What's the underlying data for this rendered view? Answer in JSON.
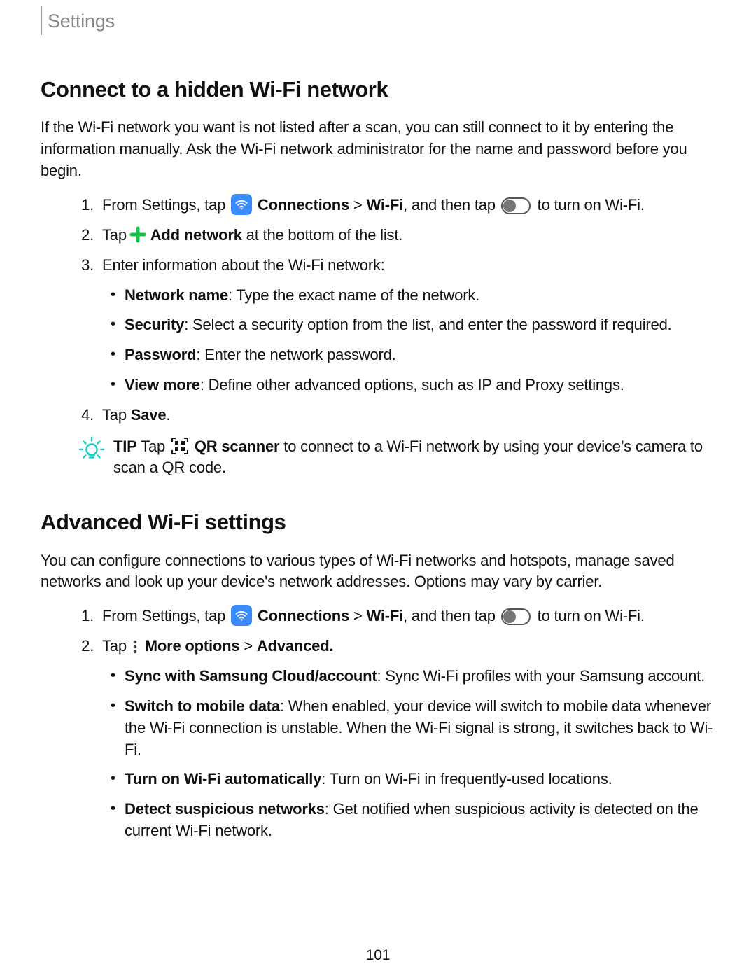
{
  "breadcrumb": "Settings",
  "page_number": "101",
  "s1": {
    "heading": "Connect to a hidden Wi-Fi network",
    "lead": "If the Wi-Fi network you want is not listed after a scan, you can still connect to it by entering the information manually. Ask the Wi-Fi network administrator for the name and password before you begin.",
    "step1_pre": "From Settings, tap ",
    "step1_conn": "Connections",
    "step1_gt": " > ",
    "step1_wifi": "Wi-Fi",
    "step1_mid": ", and then tap ",
    "step1_post": " to turn on Wi-Fi.",
    "step2_pre": "Tap ",
    "step2_add": "Add network",
    "step2_post": " at the bottom of the list.",
    "step3": "Enter information about the Wi-Fi network:",
    "b_name_l": "Network name",
    "b_name_t": ": Type the exact name of the network.",
    "b_sec_l": "Security",
    "b_sec_t": ": Select a security option from the list, and enter the password if required.",
    "b_pw_l": "Password",
    "b_pw_t": ": Enter the network password.",
    "b_vm_l": "View more",
    "b_vm_t": ": Define other advanced options, such as IP and Proxy settings.",
    "step4_pre": "Tap ",
    "step4_save": "Save",
    "step4_post": ".",
    "tip_label": "TIP",
    "tip_pre": "  Tap ",
    "tip_qr": "QR scanner",
    "tip_post": " to connect to a Wi-Fi network by using your device’s camera to scan a QR code."
  },
  "s2": {
    "heading": "Advanced Wi-Fi settings",
    "lead": "You can configure connections to various types of Wi-Fi networks and hotspots, manage saved networks and look up your device's network addresses. Options may vary by carrier.",
    "step1_pre": "From Settings, tap ",
    "step1_conn": "Connections",
    "step1_gt": " > ",
    "step1_wifi": "Wi-Fi",
    "step1_mid": ", and then tap ",
    "step1_post": " to turn on Wi-Fi.",
    "step2_pre": "Tap ",
    "step2_more": "More options",
    "step2_gt": " > ",
    "step2_adv": "Advanced.",
    "b_sync_l": "Sync with Samsung Cloud/account",
    "b_sync_t": ": Sync Wi-Fi profiles with your Samsung account.",
    "b_sw_l": "Switch to mobile data",
    "b_sw_t": ": When enabled, your device will switch to mobile data whenever the Wi-Fi connection is unstable. When the Wi-Fi signal is strong, it switches back to Wi-Fi.",
    "b_auto_l": "Turn on Wi-Fi automatically",
    "b_auto_t": ": Turn on Wi-Fi in frequently-used locations.",
    "b_det_l": "Detect suspicious networks",
    "b_det_t": ": Get notified when suspicious activity is detected on the current Wi-Fi network."
  }
}
